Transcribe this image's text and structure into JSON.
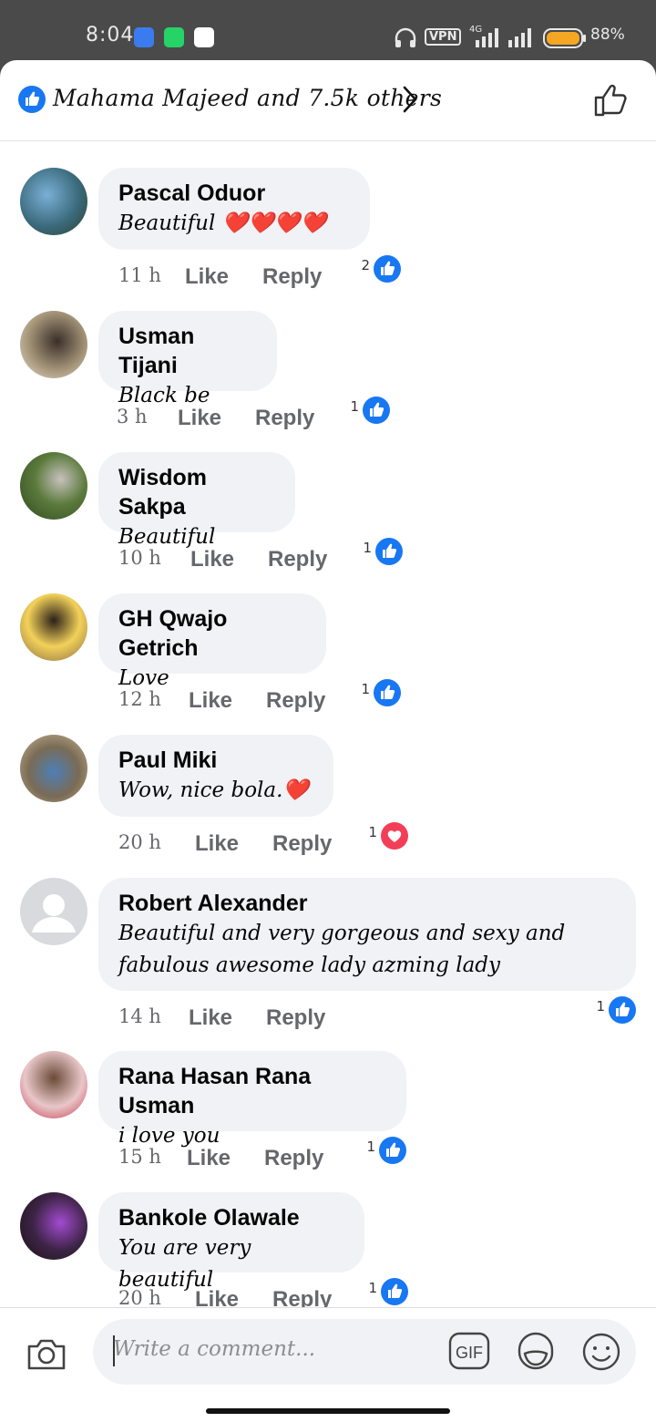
{
  "status_bar": {
    "time": "8:04",
    "vpn": "VPN",
    "network": "4G",
    "battery": "88%"
  },
  "header": {
    "likes_text": "Mahama Majeed and 7.5k others"
  },
  "comments": [
    {
      "name": "Pascal Oduor",
      "text": "Beautiful ❤️❤️❤️❤️",
      "time": "11 h",
      "like": "Like",
      "reply": "Reply",
      "reaction_count": "2",
      "reaction": "like"
    },
    {
      "name": "Usman Tijani",
      "text": "Black be",
      "time": "3 h",
      "like": "Like",
      "reply": "Reply",
      "reaction_count": "1",
      "reaction": "like"
    },
    {
      "name": "Wisdom Sakpa",
      "text": "Beautiful",
      "time": "10 h",
      "like": "Like",
      "reply": "Reply",
      "reaction_count": "1",
      "reaction": "like"
    },
    {
      "name": "GH Qwajo Getrich",
      "text": "Love",
      "time": "12 h",
      "like": "Like",
      "reply": "Reply",
      "reaction_count": "1",
      "reaction": "like"
    },
    {
      "name": "Paul Miki",
      "text": "Wow, nice bola.❤️",
      "time": "20 h",
      "like": "Like",
      "reply": "Reply",
      "reaction_count": "1",
      "reaction": "love"
    },
    {
      "name": "Robert Alexander",
      "text": "Beautiful and very gorgeous and sexy and fabulous awesome lady azming lady",
      "time": "14 h",
      "like": "Like",
      "reply": "Reply",
      "reaction_count": "1",
      "reaction": "like"
    },
    {
      "name": "Rana Hasan Rana Usman",
      "text": "i love you",
      "time": "15 h",
      "like": "Like",
      "reply": "Reply",
      "reaction_count": "1",
      "reaction": "like"
    },
    {
      "name": "Bankole Olawale",
      "text": "You are very beautiful",
      "time": "20 h",
      "like": "Like",
      "reply": "Reply",
      "reaction_count": "1",
      "reaction": "like"
    }
  ],
  "composer": {
    "placeholder": "Write a comment..."
  },
  "colors": {
    "like_blue": "#1877f2",
    "love_red": "#f33e58",
    "bubble": "#f0f2f5",
    "meta_gray": "#65676b"
  },
  "icons": [
    "like-icon",
    "chevron-right-icon",
    "thumbs-up-outline-icon",
    "camera-icon",
    "gif-icon",
    "sticker-icon",
    "emoji-icon"
  ]
}
